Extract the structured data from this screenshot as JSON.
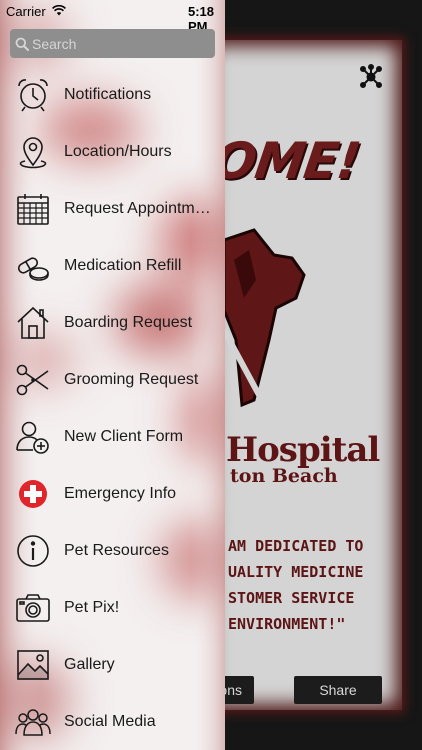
{
  "status_bar": {
    "carrier": "Carrier",
    "time": "5:18 PM"
  },
  "search": {
    "placeholder": "Search"
  },
  "menu": {
    "items": [
      {
        "label": "Notifications",
        "icon": "alarm-clock-icon"
      },
      {
        "label": "Location/Hours",
        "icon": "map-pin-icon"
      },
      {
        "label": "Request Appointment",
        "icon": "calendar-icon"
      },
      {
        "label": "Medication Refill",
        "icon": "pills-icon"
      },
      {
        "label": "Boarding Request",
        "icon": "house-icon"
      },
      {
        "label": "Grooming Request",
        "icon": "scissors-icon"
      },
      {
        "label": "New Client Form",
        "icon": "add-user-icon"
      },
      {
        "label": "Emergency Info",
        "icon": "red-cross-icon"
      },
      {
        "label": "Pet Resources",
        "icon": "info-icon"
      },
      {
        "label": "Pet Pix!",
        "icon": "camera-icon"
      },
      {
        "label": "Gallery",
        "icon": "image-icon"
      },
      {
        "label": "Social Media",
        "icon": "group-icon"
      }
    ]
  },
  "background": {
    "welcome_text": "OME!",
    "hospital_text": "Hospital",
    "beach_text": "ton Beach",
    "quote_lines": [
      "AM DEDICATED TO",
      "UALITY MEDICINE",
      "STOMER SERVICE",
      "ENVIRONMENT!\""
    ],
    "left_button_label": "ons",
    "share_button_label": "Share"
  },
  "colors": {
    "drawer_bg": "#f3efef",
    "accent_red": "#e0252b",
    "brand_maroon": "#5c1414"
  }
}
